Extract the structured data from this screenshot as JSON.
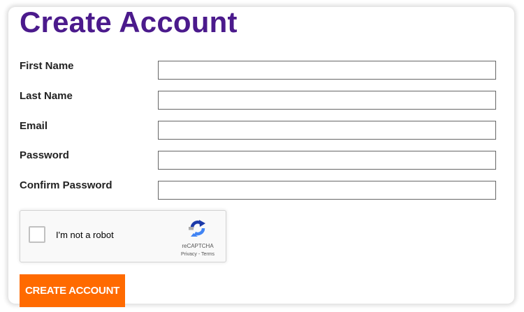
{
  "page": {
    "title": "Create Account"
  },
  "form": {
    "fields": [
      {
        "label": "First Name",
        "value": ""
      },
      {
        "label": "Last Name",
        "value": ""
      },
      {
        "label": "Email",
        "value": ""
      },
      {
        "label": "Password",
        "value": ""
      },
      {
        "label": "Confirm Password",
        "value": ""
      }
    ],
    "submit_label": "CREATE ACCOUNT"
  },
  "recaptcha": {
    "label": "I'm not a robot",
    "brand": "reCAPTCHA",
    "privacy_label": "Privacy",
    "separator": " - ",
    "terms_label": "Terms",
    "checked": false
  },
  "colors": {
    "title": "#4b1a8c",
    "button": "#ff6a00",
    "button_text": "#ffffff"
  }
}
